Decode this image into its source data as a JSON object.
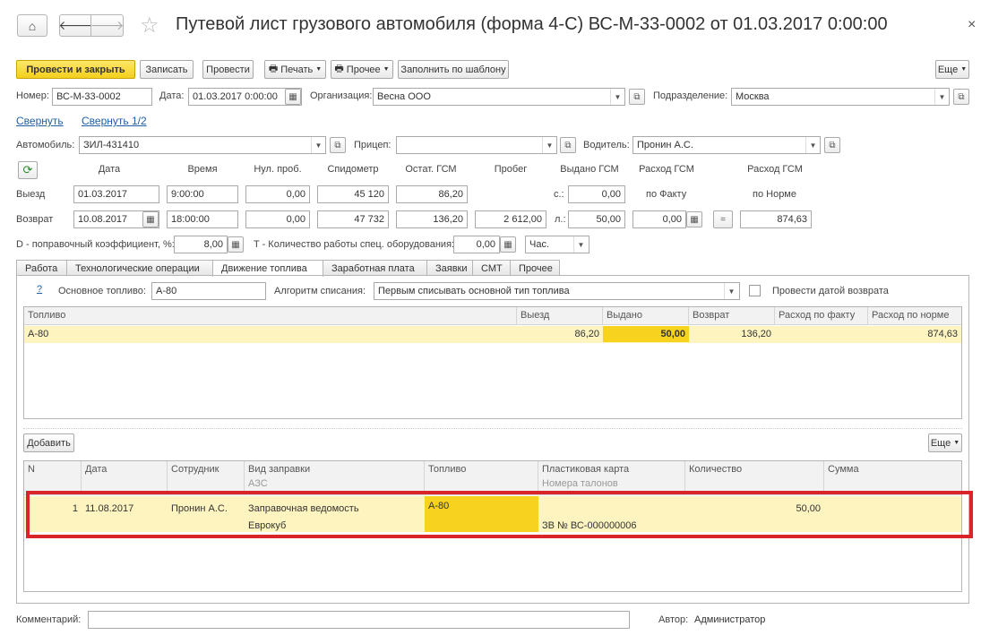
{
  "window": {
    "title": "Путевой лист грузового автомобиля (форма 4-С) ВС-М-33-0002 от 01.03.2017 0:00:00",
    "close_label": "×"
  },
  "toolbar": {
    "post_close": "Провести и закрыть",
    "save": "Записать",
    "post": "Провести",
    "print": "Печать",
    "other": "Прочее",
    "fill_template": "Заполнить по шаблону",
    "more": "Еще"
  },
  "header": {
    "number_label": "Номер:",
    "number_value": "ВС-М-33-0002",
    "date_label": "Дата:",
    "date_value": "01.03.2017  0:00:00",
    "org_label": "Организация:",
    "org_value": "Весна ООО",
    "dept_label": "Подразделение:",
    "dept_value": "Москва"
  },
  "collapse": {
    "link1": "Свернуть",
    "link2": "Свернуть 1/2"
  },
  "vehicle": {
    "auto_label": "Автомобиль:",
    "auto_value": "ЗИЛ-431410",
    "trailer_label": "Прицеп:",
    "trailer_value": "",
    "driver_label": "Водитель:",
    "driver_value": "Пронин А.С."
  },
  "trip": {
    "cols": {
      "date": "Дата",
      "time": "Время",
      "zero": "Нул. проб.",
      "speedo": "Спидометр",
      "fuel_rest": "Остат. ГСМ",
      "mileage": "Пробег",
      "issued": "Выдано ГСМ",
      "fact": "Расход ГСМ",
      "norm": "Расход ГСМ",
      "fact_sub": "по Факту",
      "norm_sub": "по Норме"
    },
    "departure": {
      "label": "Выезд",
      "date": "01.03.2017",
      "time": "9:00:00",
      "zero": "0,00",
      "speedo": "45 120",
      "fuel": "86,20",
      "unit": "с.:",
      "issued": "0,00"
    },
    "return": {
      "label": "Возврат",
      "date": "10.08.2017",
      "time": "18:00:00",
      "zero": "0,00",
      "speedo": "47 732",
      "fuel": "136,20",
      "mileage": "2 612,00",
      "unit": "л.:",
      "issued": "50,00",
      "fact": "0,00",
      "eq": "=",
      "norm": "874,63"
    },
    "coef_label": "D - поправочный коэффициент, %:",
    "coef_value": "8,00",
    "work_label": "T - Количество работы спец. оборудования:",
    "work_value": "0,00",
    "work_unit": "Час."
  },
  "tabs": [
    "Работа",
    "Технологические операции",
    "Движение топлива",
    "Заработная плата",
    "Заявки",
    "СМТ",
    "Прочее"
  ],
  "fuel_tab": {
    "help": "?",
    "main_fuel_label": "Основное топливо:",
    "main_fuel_value": "А-80",
    "algo_label": "Алгоритм списания:",
    "algo_value": "Первым списывать основной тип топлива",
    "return_date_label": "Провести датой возврата"
  },
  "fuel_table": {
    "headers": [
      "Топливо",
      "Выезд",
      "Выдано",
      "Возврат",
      "Расход по факту",
      "Расход по норме"
    ],
    "row": {
      "fuel": "А-80",
      "departure": "86,20",
      "issued": "50,00",
      "return": "136,20",
      "fact": "",
      "norm": "874,63"
    }
  },
  "refuel": {
    "add": "Добавить",
    "more": "Еще",
    "headers": {
      "n": "N",
      "date": "Дата",
      "employee": "Сотрудник",
      "kind": "Вид заправки",
      "kind_sub": "АЗС",
      "fuel": "Топливо",
      "card": "Пластиковая карта",
      "card_sub": "Номера талонов",
      "qty": "Количество",
      "sum": "Сумма"
    },
    "row": {
      "n": "1",
      "date": "11.08.2017",
      "employee": "Пронин А.С.",
      "kind": "Заправочная ведомость",
      "station": "Еврокуб",
      "fuel": "А-80",
      "card": "",
      "coupons": "ЗВ № ВС-000000006",
      "qty": "50,00",
      "sum": ""
    }
  },
  "footer": {
    "comment_label": "Комментарий:",
    "comment_value": "",
    "author_label": "Автор:",
    "author_value": "Администратор"
  },
  "colors": {
    "accent_yellow": "#f7d21e",
    "row_highlight": "#fdf4bf",
    "highlight_frame": "#d9252a",
    "link": "#1e5fa8"
  },
  "icons": [
    "home-icon",
    "back-arrow-icon",
    "forward-arrow-icon",
    "star-icon",
    "close-icon",
    "printer-icon",
    "calendar-icon",
    "open-icon",
    "refresh-icon",
    "dropdown-icon"
  ]
}
